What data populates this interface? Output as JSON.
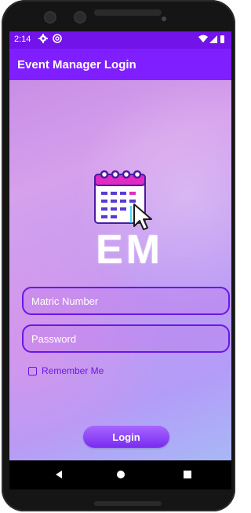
{
  "status_bar": {
    "time": "2:14"
  },
  "app_bar": {
    "title": "Event Manager Login"
  },
  "logo": {
    "text": "EM"
  },
  "form": {
    "matric_placeholder": "Matric Number",
    "password_placeholder": "Password",
    "remember_label": "Remember Me",
    "remember_checked": false,
    "login_label": "Login"
  },
  "icons": {
    "status": [
      "gear-icon",
      "at-icon",
      "wifi-icon",
      "signal-icon",
      "battery-icon"
    ],
    "logo": "calendar-icon",
    "cursor": "cursor-icon",
    "nav": [
      "back-icon",
      "home-icon",
      "recent-apps-icon"
    ]
  },
  "colors": {
    "primary": "#7f1fff",
    "status_bar": "#7213ea",
    "field_border": "#6a16e6",
    "button": "#8a3cf6"
  }
}
